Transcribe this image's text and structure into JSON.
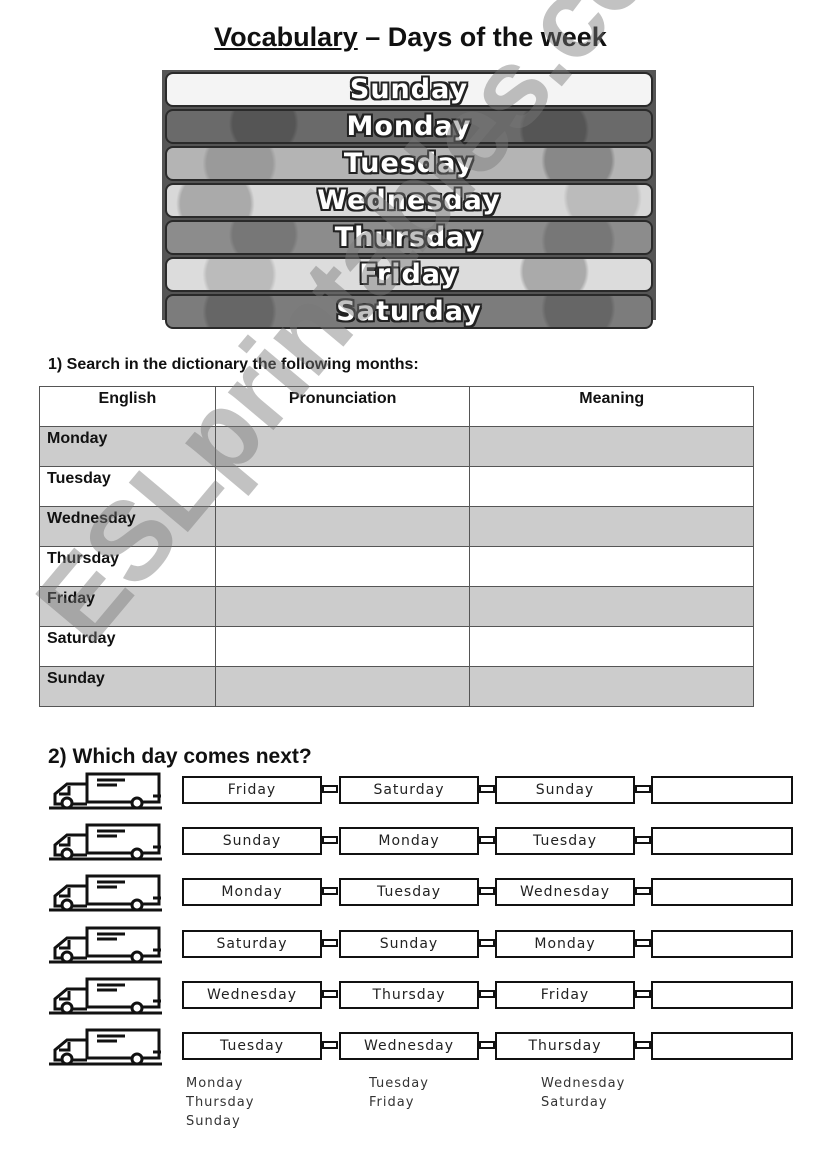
{
  "title": {
    "underlined": "Vocabulary",
    "rest": " – Days of the week"
  },
  "banner": {
    "days": [
      "Sunday",
      "Monday",
      "Tuesday",
      "Wednesday",
      "Thursday",
      "Friday",
      "Saturday"
    ]
  },
  "exercise1": {
    "instruction": "1) Search in the dictionary the following months:",
    "headers": [
      "English",
      "Pronunciation",
      "Meaning"
    ],
    "rows": [
      {
        "english": "Monday",
        "pronunciation": "",
        "meaning": ""
      },
      {
        "english": "Tuesday",
        "pronunciation": "",
        "meaning": ""
      },
      {
        "english": "Wednesday",
        "pronunciation": "",
        "meaning": ""
      },
      {
        "english": "Thursday",
        "pronunciation": "",
        "meaning": ""
      },
      {
        "english": "Friday",
        "pronunciation": "",
        "meaning": ""
      },
      {
        "english": "Saturday",
        "pronunciation": "",
        "meaning": ""
      },
      {
        "english": "Sunday",
        "pronunciation": "",
        "meaning": ""
      }
    ]
  },
  "exercise2": {
    "instruction": "2) Which day comes next?",
    "icon": "truck-icon",
    "trains": [
      [
        "Friday",
        "Saturday",
        "Sunday",
        ""
      ],
      [
        "Sunday",
        "Monday",
        "Tuesday",
        ""
      ],
      [
        "Monday",
        "Tuesday",
        "Wednesday",
        ""
      ],
      [
        "Saturday",
        "Sunday",
        "Monday",
        ""
      ],
      [
        "Wednesday",
        "Thursday",
        "Friday",
        ""
      ],
      [
        "Tuesday",
        "Wednesday",
        "Thursday",
        ""
      ]
    ],
    "word_bank": [
      "Monday",
      "Tuesday",
      "Wednesday",
      "Thursday",
      "Friday",
      "Saturday",
      "Sunday"
    ]
  },
  "watermark": "ESLprintables.com"
}
